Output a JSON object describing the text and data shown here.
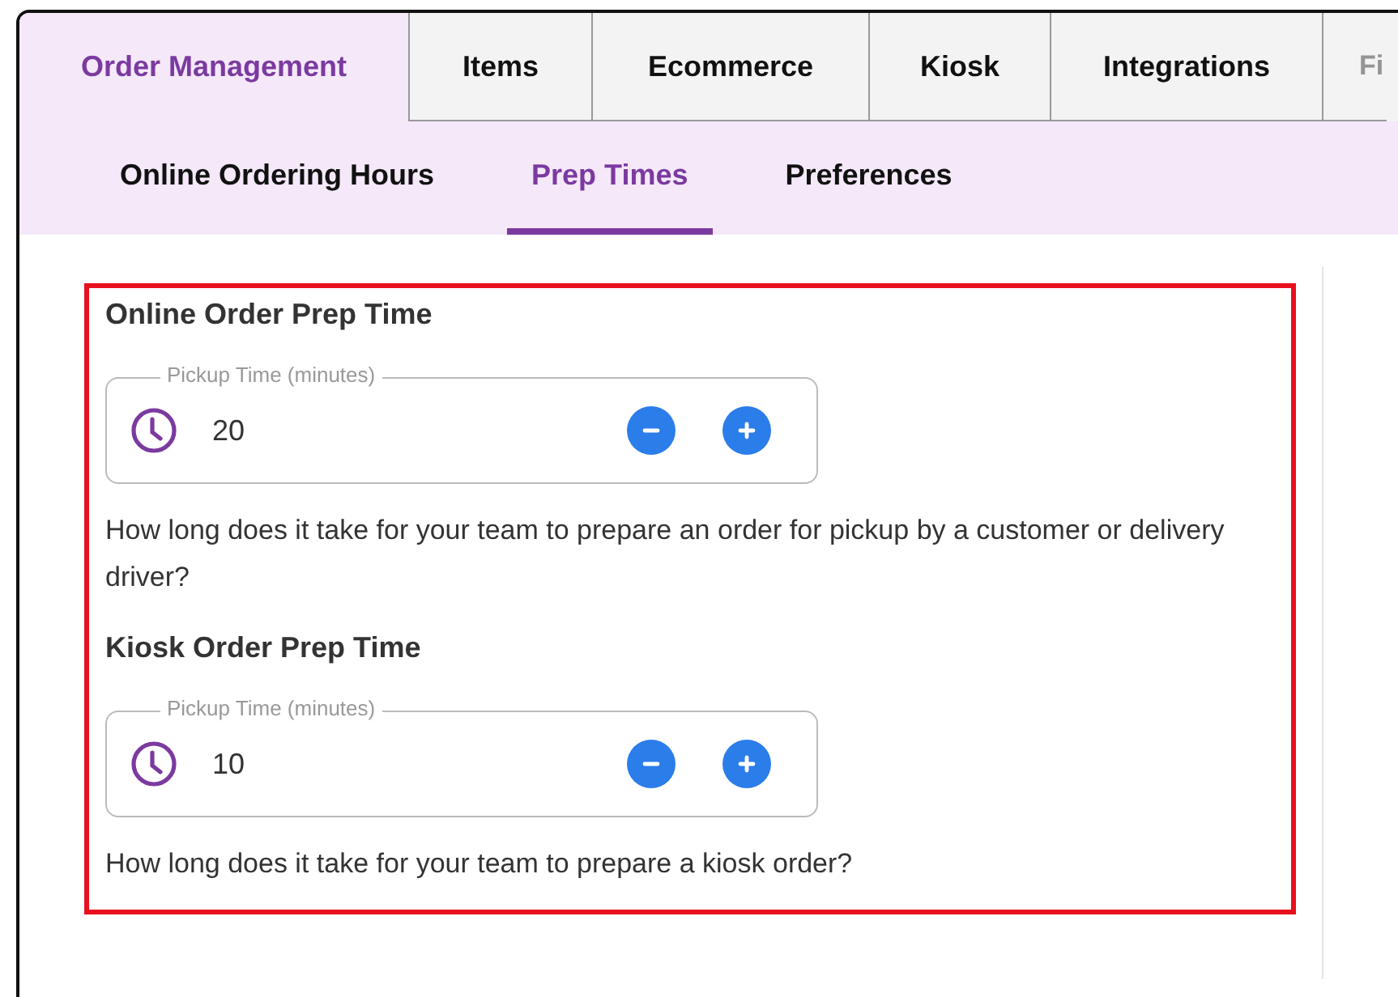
{
  "tabs": [
    {
      "label": "Order Management",
      "selected": true,
      "disabled": false
    },
    {
      "label": "Items",
      "selected": false,
      "disabled": false
    },
    {
      "label": "Ecommerce",
      "selected": false,
      "disabled": false
    },
    {
      "label": "Kiosk",
      "selected": false,
      "disabled": false
    },
    {
      "label": "Integrations",
      "selected": false,
      "disabled": false
    },
    {
      "label": "Fi",
      "selected": false,
      "disabled": true
    }
  ],
  "subtabs": [
    {
      "label": "Online Ordering Hours",
      "selected": false
    },
    {
      "label": "Prep Times",
      "selected": true
    },
    {
      "label": "Preferences",
      "selected": false
    }
  ],
  "sections": [
    {
      "heading": "Online Order Prep Time",
      "field": {
        "label": "Pickup Time (minutes)",
        "value": "20"
      },
      "help": "How long does it take for your team to prepare an order for pickup by a customer or delivery driver?"
    },
    {
      "heading": "Kiosk Order Prep Time",
      "field": {
        "label": "Pickup Time (minutes)",
        "value": "10"
      },
      "help": "How long does it take for your team to prepare a kiosk order?"
    }
  ]
}
